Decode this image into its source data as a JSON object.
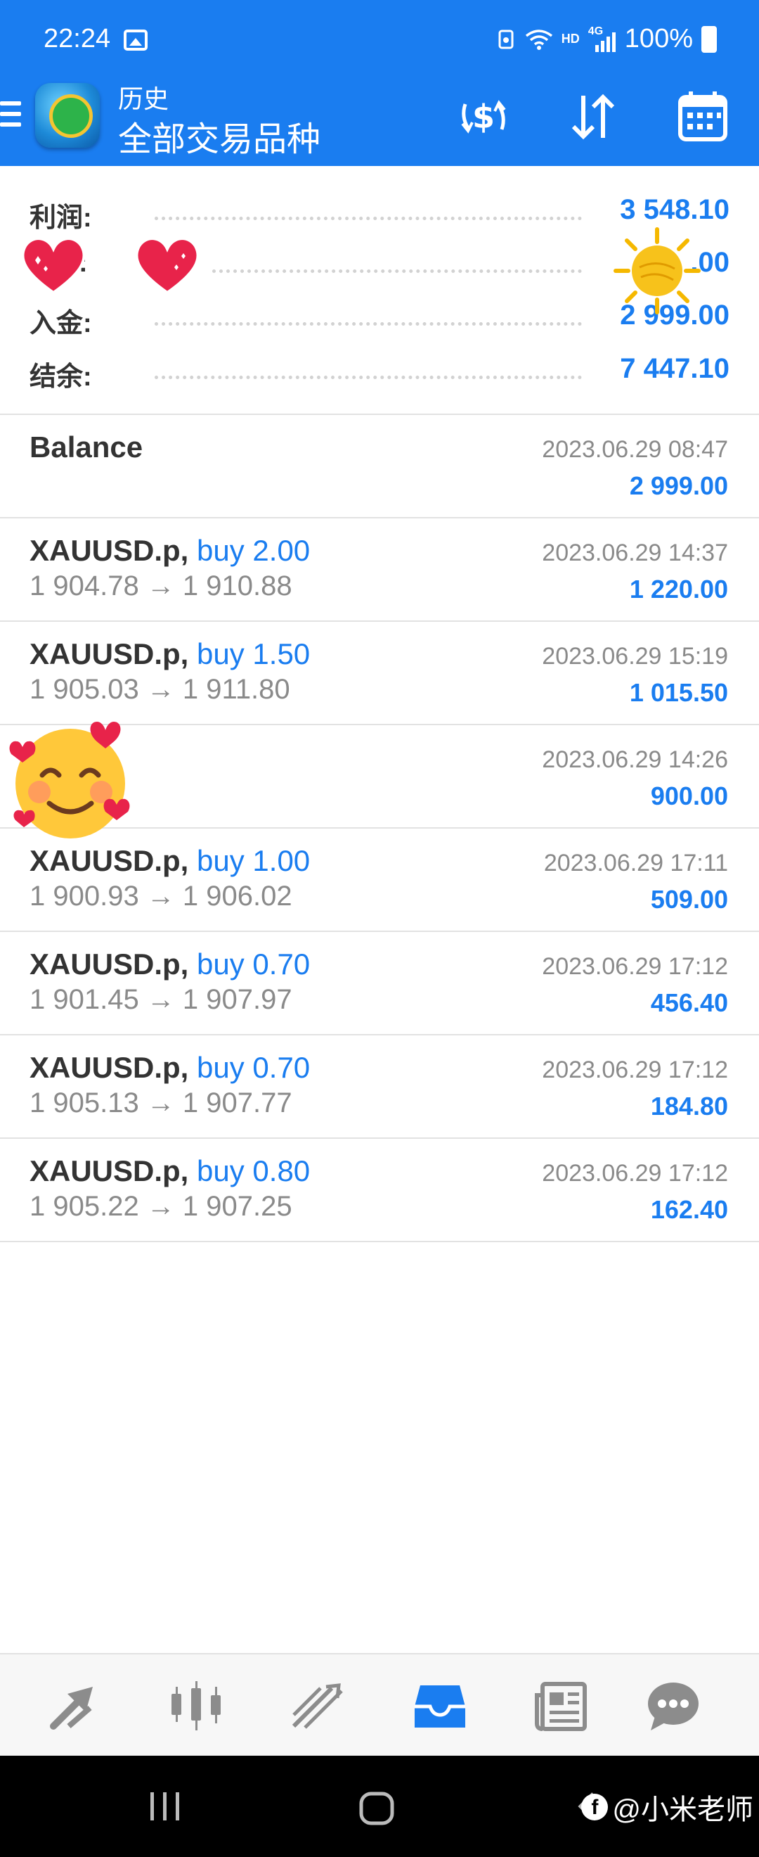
{
  "status_bar": {
    "time": "22:24",
    "hd": "HD",
    "net": "4G",
    "battery": "100%"
  },
  "header": {
    "subtitle": "历史",
    "title": "全部交易品种"
  },
  "summary": [
    {
      "label": "利润:",
      "value": "3 548.10"
    },
    {
      "label": ":",
      "value": ".00"
    },
    {
      "label": "入金:",
      "value": "2 999.00"
    },
    {
      "label": "结余:",
      "value": "7 447.10"
    }
  ],
  "deals": [
    {
      "symbol": "Balance",
      "side": "",
      "prices": "",
      "date": "2023.06.29 08:47",
      "profit": "2 999.00"
    },
    {
      "symbol": "XAUUSD.p,",
      "side": "buy 2.00",
      "prices": "1 904.78 → 1 910.88",
      "date": "2023.06.29 14:37",
      "profit": "1 220.00"
    },
    {
      "symbol": "XAUUSD.p,",
      "side": "buy 1.50",
      "prices": "1 905.03 → 1 911.80",
      "date": "2023.06.29 15:19",
      "profit": "1 015.50"
    },
    {
      "symbol": "",
      "side": "",
      "prices": "",
      "date": "2023.06.29 14:26",
      "profit": "900.00"
    },
    {
      "symbol": "XAUUSD.p,",
      "side": "buy 1.00",
      "prices": "1 900.93 → 1 906.02",
      "date": "2023.06.29 17:11",
      "profit": "509.00"
    },
    {
      "symbol": "XAUUSD.p,",
      "side": "buy 0.70",
      "prices": "1 901.45 → 1 907.97",
      "date": "2023.06.29 17:12",
      "profit": "456.40"
    },
    {
      "symbol": "XAUUSD.p,",
      "side": "buy 0.70",
      "prices": "1 905.13 → 1 907.77",
      "date": "2023.06.29 17:12",
      "profit": "184.80"
    },
    {
      "symbol": "XAUUSD.p,",
      "side": "buy 0.80",
      "prices": "1 905.22 → 1 907.25",
      "date": "2023.06.29 17:12",
      "profit": "162.40"
    }
  ],
  "nav": [
    "trade-icon",
    "chart-icon",
    "history-icon",
    "inbox-icon",
    "news-icon",
    "chat-icon"
  ],
  "watermark": {
    "name": "@小米老师"
  },
  "colors": {
    "accent": "#1a7df0",
    "text": "#333333",
    "muted": "#8a8a8a"
  }
}
